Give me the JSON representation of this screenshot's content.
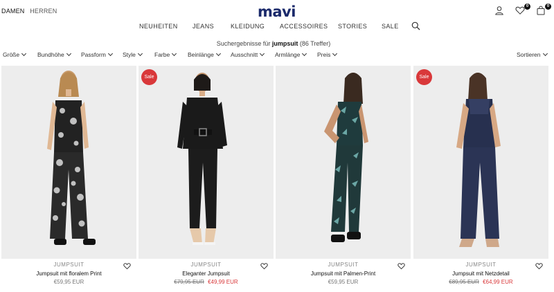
{
  "header": {
    "gender_tabs": [
      {
        "label": "DAMEN",
        "active": true
      },
      {
        "label": "HERREN",
        "active": false
      }
    ],
    "logo": "mavi",
    "wishlist_count": "0",
    "cart_count": "0"
  },
  "nav": {
    "items": [
      "NEUHEITEN",
      "JEANS",
      "KLEIDUNG",
      "ACCESSOIRES",
      "STORIES",
      "SALE"
    ]
  },
  "search_results": {
    "prefix": "Suchergebnisse für",
    "query": "jumpsuit",
    "count_text": "(86 Treffer)"
  },
  "filters": [
    "Größe",
    "Bundhöhe",
    "Passform",
    "Style",
    "Farbe",
    "Beinlänge",
    "Ausschnitt",
    "Armlänge",
    "Preis"
  ],
  "sort_label": "Sortieren",
  "products": [
    {
      "category": "JUMPSUIT",
      "name": "Jumpsuit mit floralem Print",
      "price": "€59,95 EUR",
      "old_price": "",
      "sale": false,
      "sale_label": ""
    },
    {
      "category": "JUMPSUIT",
      "name": "Eleganter Jumpsuit",
      "price": "€49,99 EUR",
      "old_price": "€79,95 EUR",
      "sale": true,
      "sale_label": "Sale"
    },
    {
      "category": "JUMPSUIT",
      "name": "Jumpsuit mit Palmen-Print",
      "price": "€59,95 EUR",
      "old_price": "",
      "sale": false,
      "sale_label": ""
    },
    {
      "category": "JUMPSUIT",
      "name": "Jumpsuit mit Netzdetail",
      "price": "€64,99 EUR",
      "old_price": "€89,95 EUR",
      "sale": true,
      "sale_label": "Sale"
    }
  ],
  "colors": {
    "brand": "#1b2a6b",
    "sale": "#d9383a",
    "photo_bg": "#eeeeee"
  }
}
